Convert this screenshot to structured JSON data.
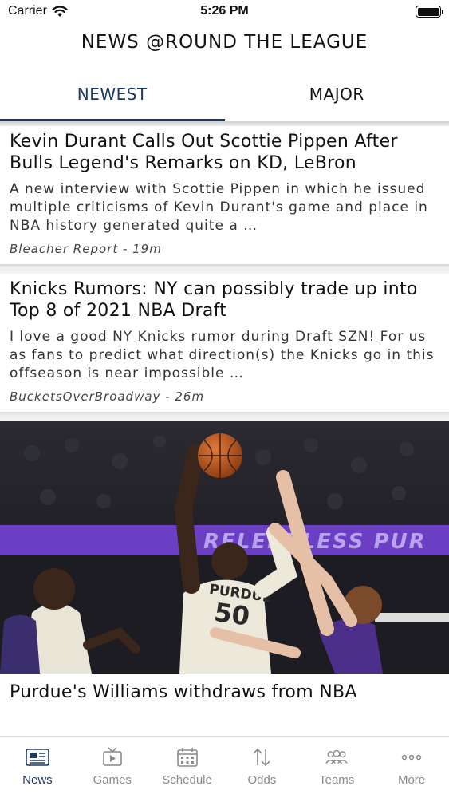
{
  "status_bar": {
    "carrier": "Carrier",
    "time": "5:26 PM"
  },
  "header": {
    "title": "NEWS @ROUND THE LEAGUE"
  },
  "tabs": [
    {
      "label": "NEWEST",
      "active": true
    },
    {
      "label": "MAJOR",
      "active": false
    }
  ],
  "articles": [
    {
      "title": "Kevin Durant Calls Out Scottie Pippen After Bulls Legend's Remarks on KD, LeBron",
      "summary": "A new interview with Scottie Pippen in which he issued multiple criticisms of Kevin Durant's game and place in NBA history generated quite a …",
      "source": "Bleacher Report - 19m"
    },
    {
      "title": "Knicks Rumors: NY can possibly trade up into Top 8 of 2021 NBA Draft",
      "summary": "I love a good NY Knicks rumor during Draft SZN! For us as fans to predict what direction(s) the Knicks go in this offseason is near impossible …",
      "source": "BucketsOverBroadway - 26m"
    }
  ],
  "photo_article": {
    "title": "Purdue's Williams withdraws from NBA",
    "jersey_text": "PURDUE",
    "jersey_number": "50",
    "banner_text": "RELENTLESS PUR"
  },
  "tabbar": [
    {
      "label": "News",
      "icon": "newspaper-icon",
      "active": true
    },
    {
      "label": "Games",
      "icon": "tv-icon",
      "active": false
    },
    {
      "label": "Schedule",
      "icon": "calendar-icon",
      "active": false
    },
    {
      "label": "Odds",
      "icon": "arrows-updown-icon",
      "active": false
    },
    {
      "label": "Teams",
      "icon": "people-icon",
      "active": false
    },
    {
      "label": "More",
      "icon": "ellipsis-icon",
      "active": false
    }
  ],
  "colors": {
    "accent": "#1b3a63",
    "inactive": "#8a8a8a",
    "banner": "#6b3fc4"
  }
}
